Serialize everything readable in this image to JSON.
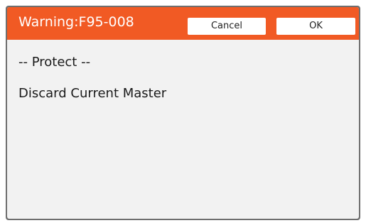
{
  "dialog": {
    "title": "Warning:F95-008",
    "buttons": {
      "cancel_label": "Cancel",
      "ok_label": "OK"
    },
    "message_lines": [
      "-- Protect --",
      "Discard Current Master"
    ]
  },
  "colors": {
    "title_bar": "#f15a24",
    "dialog_background": "#f2f2f2",
    "frame": "#6e6e6e",
    "button_background": "#ffffff"
  }
}
